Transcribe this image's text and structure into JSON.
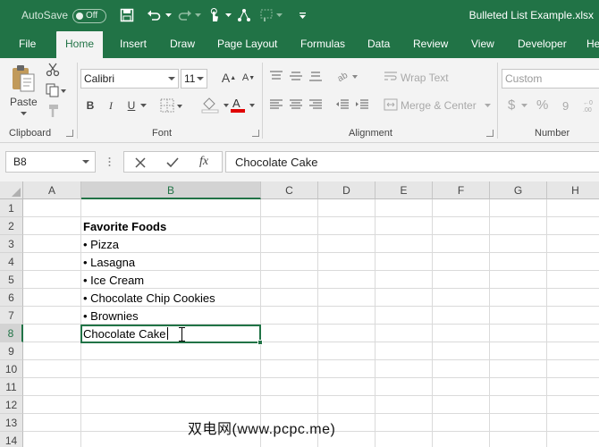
{
  "titlebar": {
    "autosave_label": "AutoSave",
    "autosave_state": "Off",
    "filename": "Bulleted List Example.xlsx",
    "quick_access_icons": [
      "save-icon",
      "undo-icon",
      "redo-icon",
      "touch-mode-icon",
      "format-painter-icon",
      "customize-icon"
    ]
  },
  "tabs": [
    "File",
    "Home",
    "Insert",
    "Draw",
    "Page Layout",
    "Formulas",
    "Data",
    "Review",
    "View",
    "Developer",
    "He"
  ],
  "active_tab": "Home",
  "ribbon": {
    "clipboard": {
      "paste_label": "Paste",
      "group_label": "Clipboard"
    },
    "font": {
      "font_name": "Calibri",
      "font_size": "11",
      "group_label": "Font",
      "font_color": "#e00000"
    },
    "alignment": {
      "wrap_text": "Wrap Text",
      "merge_center": "Merge & Center",
      "group_label": "Alignment"
    },
    "number": {
      "format": "Custom",
      "group_label": "Number",
      "dollar": "$",
      "percent": "%"
    }
  },
  "formula_bar": {
    "name_box": "B8",
    "fx_label": "fx",
    "content": "Chocolate Cake"
  },
  "grid": {
    "columns": [
      "A",
      "B",
      "C",
      "D",
      "E",
      "F",
      "G",
      "H"
    ],
    "rows": [
      "1",
      "2",
      "3",
      "4",
      "5",
      "6",
      "7",
      "8",
      "9",
      "10",
      "11",
      "12",
      "13",
      "14"
    ],
    "selected_column": "B",
    "selected_row": "8",
    "cells": {
      "B2": "Favorite Foods",
      "B3": "• Pizza",
      "B4": "• Lasagna",
      "B5": "• Ice Cream",
      "B6": "• Chocolate Chip Cookies",
      "B7": "• Brownies",
      "B8": "Chocolate Cake"
    }
  },
  "watermark": "双电网(www.pcpc.me)",
  "colors": {
    "brand": "#217346",
    "ribbon_bg": "#f3f3f3"
  }
}
